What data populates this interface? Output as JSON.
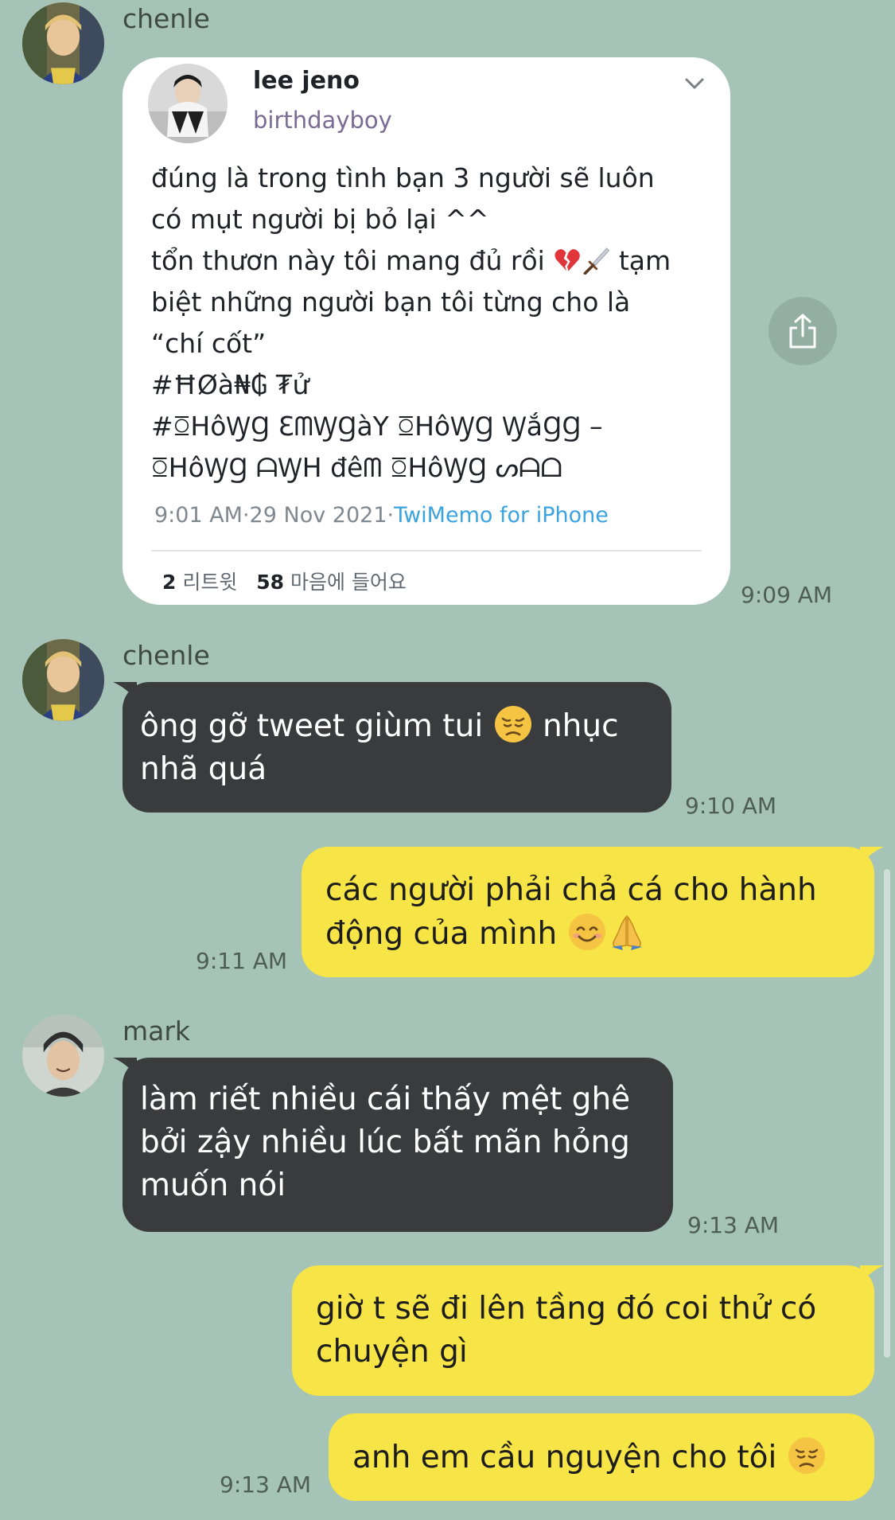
{
  "messages": [
    {
      "sender": "chenle",
      "type": "tweet",
      "time": "9:09 AM",
      "tweet": {
        "name": "lee jeno",
        "handle": "birthdayboy",
        "lines": [
          "đúng là trong tình bạn 3 người sẽ luôn",
          "có mụt người bị bỏ lại ^^",
          "tổn thươn này tôi mang đủ rồi",
          "tạm",
          "biệt những người bạn tôi từng cho là",
          "“chí cốt”",
          "#ĦØà₦₲ ₮ử",
          "#ꗞHôꝠꞬ ƐᗰꝠꞬàY ꗞHôꝠꞬ ꝠắꞬꞬ –",
          "ꗞHôꝠꞬ ᗩꝠH đêᗰ ꗞHôꝠꞬ ᔕᗩᗝ"
        ],
        "meta_time": "9:01 AM·29 Nov 2021·",
        "meta_source": "TwiMemo for iPhone",
        "retweet_count": "2",
        "retweet_label": "리트윗",
        "like_count": "58",
        "like_label": "마음에 들어요"
      }
    },
    {
      "sender": "chenle",
      "type": "text",
      "time": "9:10 AM",
      "lines": [
        "ông gỡ tweet giùm tui",
        "nhục",
        "nhã quá"
      ]
    },
    {
      "sender": "me",
      "type": "text",
      "time": "9:11 AM",
      "lines": [
        "các người phải chả cá cho hành",
        "động của mình"
      ]
    },
    {
      "sender": "mark",
      "type": "text",
      "time": "9:13 AM",
      "lines": [
        "làm riết nhiều cái thấy mệt ghê",
        "bởi zậy nhiều lúc bất mãn hỏng",
        "muốn nói"
      ]
    },
    {
      "sender": "me",
      "type": "text",
      "time": "",
      "lines": [
        "giờ t sẽ đi lên tầng đó coi thử có",
        "chuyện gì"
      ]
    },
    {
      "sender": "me",
      "type": "text",
      "time": "9:13 AM",
      "lines": [
        "anh em cầu nguyện cho tôi"
      ]
    }
  ],
  "icons": {
    "share": "share-icon",
    "chevron": "chevron-down-icon",
    "broken_heart": "broken-heart-emoji",
    "dagger": "dagger-emoji",
    "disappointed": "disappointed-face-emoji",
    "smile": "smiling-face-emoji",
    "pray": "folded-hands-emoji"
  },
  "colors": {
    "background": "#a5c4b7",
    "incoming_bubble": "#3a3b3c",
    "outgoing_bubble": "#f7e547",
    "tweet_source": "#3aa3e0"
  }
}
